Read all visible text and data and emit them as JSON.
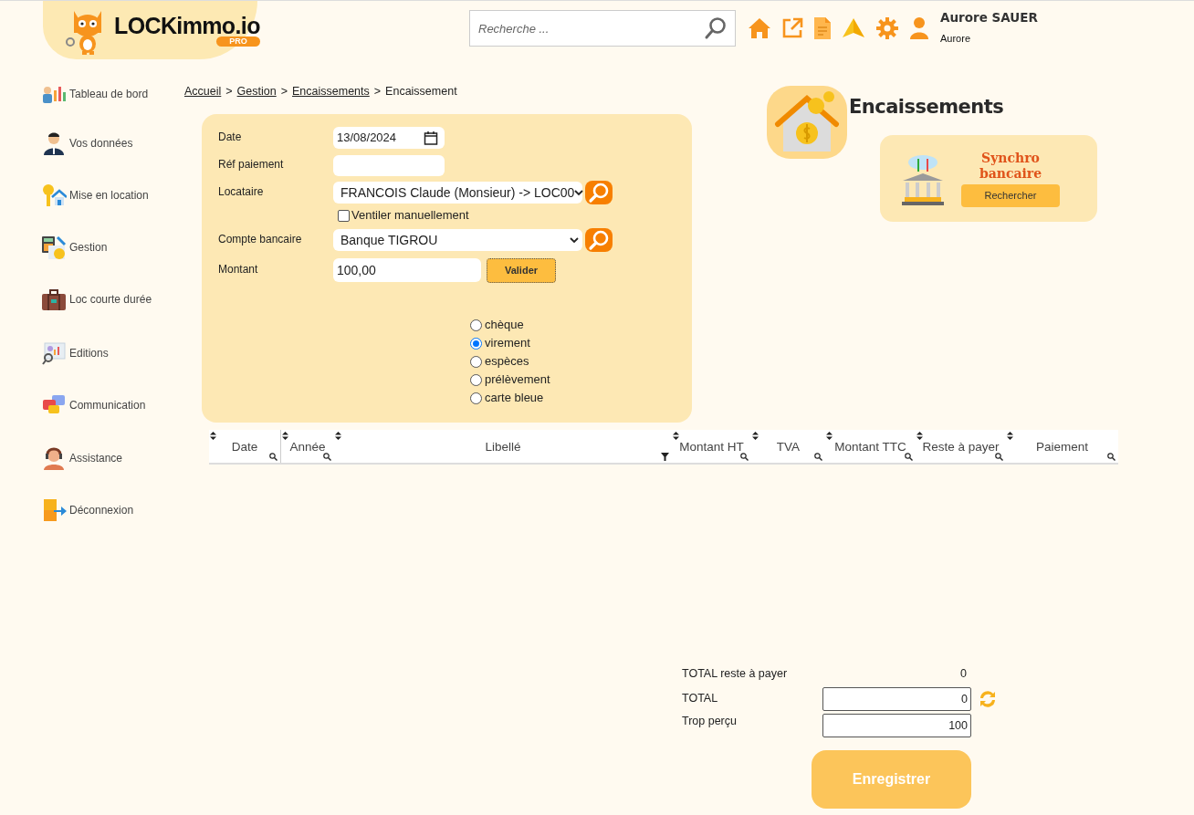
{
  "header": {
    "logo": {
      "text": "LOCKimmo.io",
      "badge": "PRO"
    },
    "search": {
      "placeholder": "Recherche ..."
    },
    "user": {
      "name": "Aurore SAUER",
      "subtitle": "Aurore"
    }
  },
  "sidebar": {
    "items": [
      {
        "label": "Tableau de bord"
      },
      {
        "label": "Vos données"
      },
      {
        "label": "Mise en location"
      },
      {
        "label": "Gestion"
      },
      {
        "label": "Loc courte durée"
      },
      {
        "label": "Editions"
      },
      {
        "label": "Communication"
      },
      {
        "label": "Assistance"
      },
      {
        "label": "Déconnexion"
      }
    ]
  },
  "breadcrumb": [
    {
      "kind": "link",
      "label": "Accueil"
    },
    {
      "kind": "separator",
      "label": ">"
    },
    {
      "kind": "link",
      "label": "Gestion"
    },
    {
      "kind": "separator",
      "label": ">"
    },
    {
      "kind": "link",
      "label": "Encaissements"
    },
    {
      "kind": "separator",
      "label": ">"
    },
    {
      "kind": "current",
      "label": "Encaissement"
    }
  ],
  "form": {
    "fields": [
      {
        "kind": "date",
        "label": "Date",
        "value": "13/08/2024"
      },
      {
        "kind": "text",
        "label": "Réf paiement"
      },
      {
        "kind": "select",
        "label": "Locataire",
        "value": "FRANCOIS Claude (Monsieur) -> LOC00"
      },
      {
        "kind": "checkbox",
        "label": "Ventiler manuellement",
        "checked": false
      },
      {
        "kind": "select",
        "label": "Compte bancaire",
        "value": "Banque TIGROU"
      },
      {
        "kind": "amount",
        "label": "Montant",
        "value": "100,00",
        "button": "Valider"
      }
    ],
    "payment_modes": [
      {
        "label": "chèque",
        "selected": false
      },
      {
        "label": "virement",
        "selected": true
      },
      {
        "label": "espèces",
        "selected": false
      },
      {
        "label": "prélèvement",
        "selected": false
      },
      {
        "label": "carte bleue",
        "selected": false
      }
    ]
  },
  "page_title": "Encaissements",
  "synchro": {
    "title": "Synchro bancaire",
    "button": "Rechercher"
  },
  "table": {
    "columns": [
      {
        "label": "Date",
        "kind": "search"
      },
      {
        "label": "Année",
        "kind": "search"
      },
      {
        "label": "Libellé",
        "kind": "filter"
      },
      {
        "label": "Montant HT",
        "kind": "search"
      },
      {
        "label": "TVA",
        "kind": "search"
      },
      {
        "label": "Montant TTC",
        "kind": "search"
      },
      {
        "label": "Reste à payer",
        "kind": "search"
      },
      {
        "label": "Paiement",
        "kind": "search"
      }
    ]
  },
  "totals": [
    {
      "kind": "text",
      "label": "TOTAL reste à payer",
      "value": "0"
    },
    {
      "kind": "refresh",
      "label": "TOTAL",
      "value": "0"
    },
    {
      "kind": "input",
      "label": "Trop perçu",
      "value": "100"
    }
  ],
  "save_button": "Enregistrer"
}
